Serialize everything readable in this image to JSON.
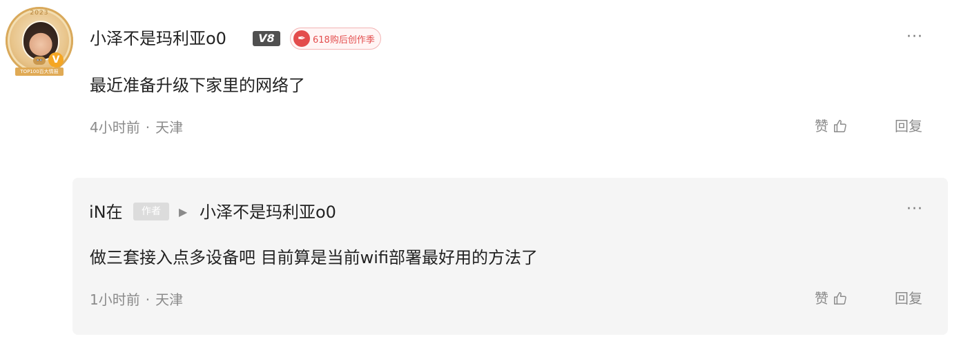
{
  "avatar": {
    "year": "2023",
    "ribbon": "TOP100百大情报",
    "badge": "V",
    "eye_badge": "👓"
  },
  "comment": {
    "username": "小泽不是玛利亚o0",
    "level": "V8",
    "event_badge": "618购后创作季",
    "text": "最近准备升级下家里的网络了",
    "time": "4小时前",
    "location": "天津",
    "separator": "·",
    "like_label": "赞",
    "reply_label": "回复",
    "more": "···"
  },
  "reply": {
    "author": "iN在",
    "author_tag": "作者",
    "arrow": "▶",
    "target": "小泽不是玛利亚o0",
    "text": "做三套接入点多设备吧 目前算是当前wifi部署最好用的方法了",
    "time": "1小时前",
    "location": "天津",
    "separator": "·",
    "like_label": "赞",
    "reply_label": "回复",
    "more": "···"
  },
  "colors": {
    "text_primary": "#222222",
    "text_secondary": "#8a8a8a",
    "reply_background": "#f5f5f5",
    "event_red": "#e34c4c",
    "level_badge": "#505050"
  }
}
